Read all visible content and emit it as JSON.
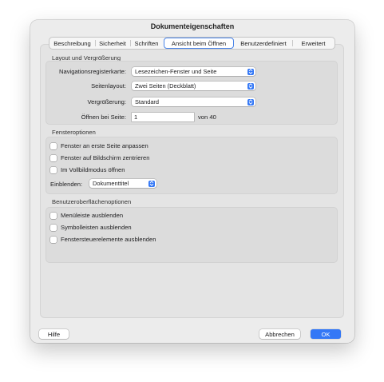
{
  "window": {
    "title": "Dokumenteigenschaften"
  },
  "tabs": [
    {
      "label": "Beschreibung",
      "active": false
    },
    {
      "label": "Sicherheit",
      "active": false
    },
    {
      "label": "Schriften",
      "active": false
    },
    {
      "label": "Ansicht beim Öffnen",
      "active": true
    },
    {
      "label": "Benutzerdefiniert",
      "active": false
    },
    {
      "label": "Erweitert",
      "active": false
    }
  ],
  "layout": {
    "title": "Layout und Vergrößerung",
    "nav_label": "Navigationsregisterkarte:",
    "nav_value": "Lesezeichen-Fenster und Seite",
    "page_layout_label": "Seitenlayout:",
    "page_layout_value": "Zwei Seiten (Deckblatt)",
    "zoom_label": "Vergrößerung:",
    "zoom_value": "Standard",
    "open_page_label": "Öffnen bei Seite:",
    "open_page_value": "1",
    "of_pages": "von 40"
  },
  "window_options": {
    "title": "Fensteroptionen",
    "checkboxes": [
      {
        "label": "Fenster an erste Seite anpassen",
        "checked": false
      },
      {
        "label": "Fenster auf Bildschirm zentrieren",
        "checked": false
      },
      {
        "label": "Im Vollbildmodus öffnen",
        "checked": false
      }
    ],
    "show_label": "Einblenden:",
    "show_value": "Dokumenttitel"
  },
  "ui_options": {
    "title": "Benutzeroberflächenoptionen",
    "checkboxes": [
      {
        "label": "Menüleiste ausblenden",
        "checked": false
      },
      {
        "label": "Symbolleisten ausblenden",
        "checked": false
      },
      {
        "label": "Fenstersteuerelemente ausblenden",
        "checked": false
      }
    ]
  },
  "buttons": {
    "help": "Hilfe",
    "cancel": "Abbrechen",
    "ok": "OK"
  },
  "colors": {
    "accent": "#3478f6",
    "window_bg": "#ececec",
    "group_bg": "#dcdcdc"
  }
}
